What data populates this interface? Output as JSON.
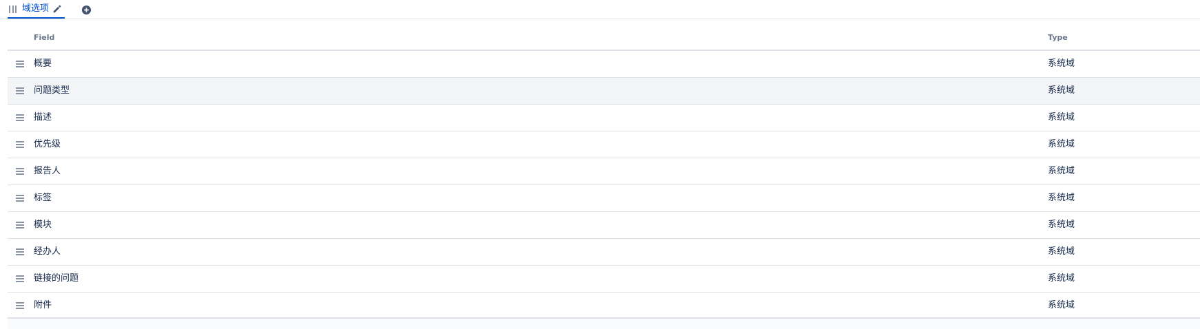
{
  "tabs": {
    "active_tab": {
      "label": "域选项"
    }
  },
  "table": {
    "columns": {
      "field": "Field",
      "type": "Type"
    },
    "rows": [
      {
        "field": "概要",
        "type": "系统域"
      },
      {
        "field": "问题类型",
        "type": "系统域"
      },
      {
        "field": "描述",
        "type": "系统域"
      },
      {
        "field": "优先级",
        "type": "系统域"
      },
      {
        "field": "报告人",
        "type": "系统域"
      },
      {
        "field": "标签",
        "type": "系统域"
      },
      {
        "field": "模块",
        "type": "系统域"
      },
      {
        "field": "经办人",
        "type": "系统域"
      },
      {
        "field": "链接的问题",
        "type": "系统域"
      },
      {
        "field": "附件",
        "type": "系统域"
      }
    ]
  },
  "colors": {
    "accent": "#0052cc",
    "row_hover": "#f4f5f7",
    "border": "#dfe1e6"
  },
  "icons": {
    "tab_grip": "drag-grip-icon",
    "tab_edit": "pencil-icon",
    "add_tab": "plus-circle-icon",
    "row_handle": "drag-handle-icon"
  }
}
